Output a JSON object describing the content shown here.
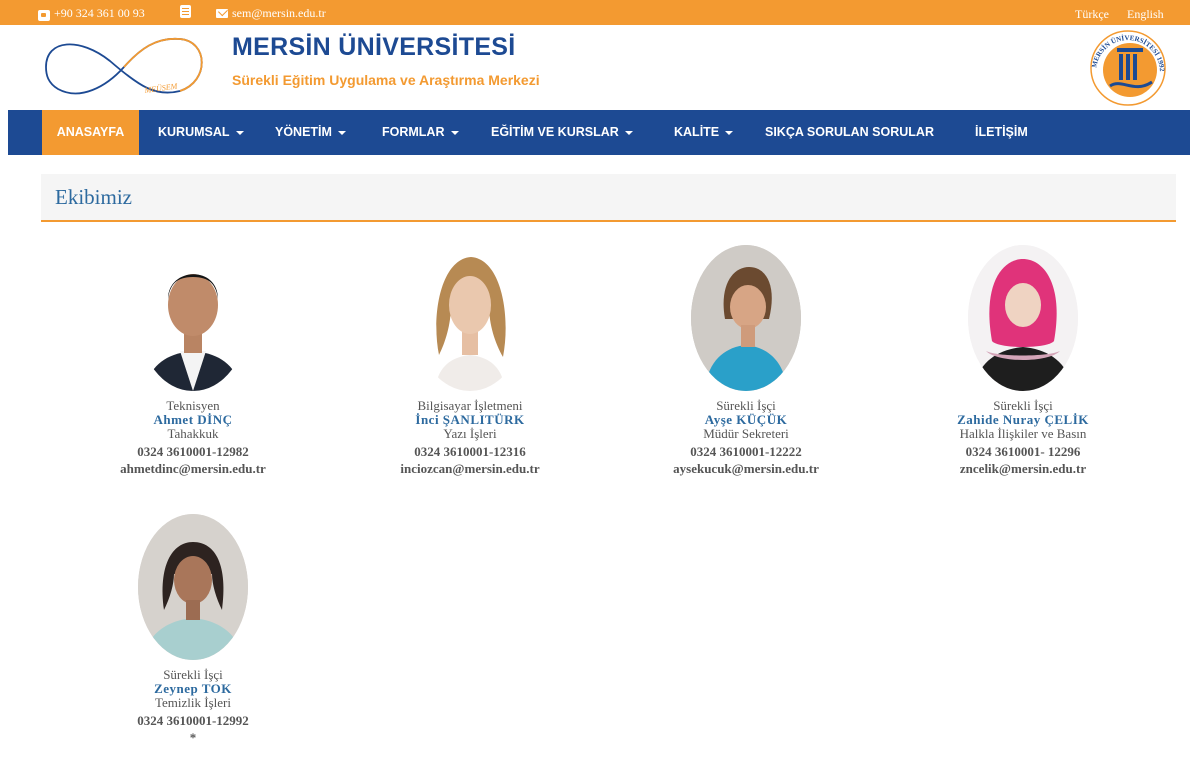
{
  "topbar": {
    "phone": "+90 324 361 00 93",
    "email": "sem@mersin.edu.tr",
    "lang_tr": "Türkçe",
    "lang_en": "English"
  },
  "header": {
    "brand": "MERSİN ÜNİVERSİTESİ",
    "subtitle": "Sürekli Eğitim Uygulama ve Araştırma Merkezi",
    "logo_text": "MEÜSEM",
    "seal_text": "MERSİN ÜNİVERSİTESİ 1992"
  },
  "nav": [
    {
      "label": "ANASAYFA",
      "dropdown": false,
      "active": true
    },
    {
      "label": "KURUMSAL",
      "dropdown": true,
      "active": false
    },
    {
      "label": "YÖNETİM",
      "dropdown": true,
      "active": false
    },
    {
      "label": "FORMLAR",
      "dropdown": true,
      "active": false
    },
    {
      "label": "EĞİTİM VE KURSLAR",
      "dropdown": true,
      "active": false
    },
    {
      "label": "KALİTE",
      "dropdown": true,
      "active": false
    },
    {
      "label": "SIKÇA SORULAN SORULAR",
      "dropdown": false,
      "active": false
    },
    {
      "label": "İLETİŞİM",
      "dropdown": false,
      "active": false
    }
  ],
  "section": {
    "title": "Ekibimiz"
  },
  "staff": [
    {
      "role": "Teknisyen",
      "name": "Ahmet DİNÇ",
      "dept": "Tahakkuk",
      "phone": "0324 3610001-12982",
      "email": "ahmetdinc@mersin.edu.tr"
    },
    {
      "role": "Bilgisayar İşletmeni",
      "name": "İnci ŞANLITÜRK",
      "dept": "Yazı İşleri",
      "phone": "0324 3610001-12316",
      "email": "inciozcan@mersin.edu.tr"
    },
    {
      "role": "Sürekli İşçi",
      "name": "Ayşe KÜÇÜK",
      "dept": "Müdür Sekreteri",
      "phone": "0324 3610001-12222",
      "email": "aysekucuk@mersin.edu.tr"
    },
    {
      "role": "Sürekli İşçi",
      "name": "Zahide Nuray ÇELİK",
      "dept": "Halkla İlişkiler ve Basın",
      "phone": "0324 3610001- 12296",
      "email": "zncelik@mersin.edu.tr"
    },
    {
      "role": "Sürekli İşçi",
      "name": "Zeynep TOK",
      "dept": "Temizlik İşleri",
      "phone": "0324 3610001-12992",
      "email": "*"
    }
  ],
  "colors": {
    "accent": "#f39a31",
    "nav": "#1d4a93",
    "link": "#2d6a9f"
  }
}
